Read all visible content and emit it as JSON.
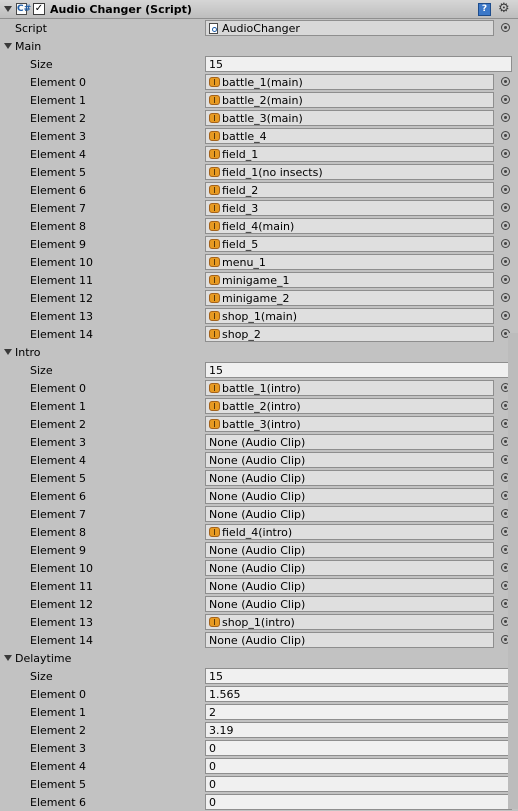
{
  "component": {
    "title": "Audio Changer (Script)",
    "enabled_mark": "✓",
    "script_icon": "C#",
    "help_icon": "?",
    "gear_icon": "⚙"
  },
  "script": {
    "label": "Script",
    "value": "AudioChanger"
  },
  "main": {
    "label": "Main",
    "size_label": "Size",
    "size": "15",
    "elements": [
      {
        "label": "Element 0",
        "value": "battle_1(main)",
        "icon": "audio-clip-icon"
      },
      {
        "label": "Element 1",
        "value": "battle_2(main)",
        "icon": "audio-clip-icon"
      },
      {
        "label": "Element 2",
        "value": "battle_3(main)",
        "icon": "audio-clip-icon"
      },
      {
        "label": "Element 3",
        "value": "battle_4",
        "icon": "audio-clip-icon"
      },
      {
        "label": "Element 4",
        "value": "field_1",
        "icon": "audio-clip-icon"
      },
      {
        "label": "Element 5",
        "value": "field_1(no insects)",
        "icon": "audio-clip-icon"
      },
      {
        "label": "Element 6",
        "value": "field_2",
        "icon": "audio-clip-icon"
      },
      {
        "label": "Element 7",
        "value": "field_3",
        "icon": "audio-clip-icon"
      },
      {
        "label": "Element 8",
        "value": "field_4(main)",
        "icon": "audio-clip-icon"
      },
      {
        "label": "Element 9",
        "value": "field_5",
        "icon": "audio-clip-icon"
      },
      {
        "label": "Element 10",
        "value": "menu_1",
        "icon": "audio-clip-icon"
      },
      {
        "label": "Element 11",
        "value": "minigame_1",
        "icon": "audio-clip-icon"
      },
      {
        "label": "Element 12",
        "value": "minigame_2",
        "icon": "audio-clip-icon"
      },
      {
        "label": "Element 13",
        "value": "shop_1(main)",
        "icon": "audio-clip-icon"
      },
      {
        "label": "Element 14",
        "value": "shop_2",
        "icon": "audio-clip-icon"
      }
    ]
  },
  "intro": {
    "label": "Intro",
    "size_label": "Size",
    "size": "15",
    "elements": [
      {
        "label": "Element 0",
        "value": "battle_1(intro)",
        "icon": "audio-clip-icon"
      },
      {
        "label": "Element 1",
        "value": "battle_2(intro)",
        "icon": "audio-clip-icon"
      },
      {
        "label": "Element 2",
        "value": "battle_3(intro)",
        "icon": "audio-clip-icon"
      },
      {
        "label": "Element 3",
        "value": "None (Audio Clip)",
        "icon": null
      },
      {
        "label": "Element 4",
        "value": "None (Audio Clip)",
        "icon": null
      },
      {
        "label": "Element 5",
        "value": "None (Audio Clip)",
        "icon": null
      },
      {
        "label": "Element 6",
        "value": "None (Audio Clip)",
        "icon": null
      },
      {
        "label": "Element 7",
        "value": "None (Audio Clip)",
        "icon": null
      },
      {
        "label": "Element 8",
        "value": "field_4(intro)",
        "icon": "audio-clip-icon"
      },
      {
        "label": "Element 9",
        "value": "None (Audio Clip)",
        "icon": null
      },
      {
        "label": "Element 10",
        "value": "None (Audio Clip)",
        "icon": null
      },
      {
        "label": "Element 11",
        "value": "None (Audio Clip)",
        "icon": null
      },
      {
        "label": "Element 12",
        "value": "None (Audio Clip)",
        "icon": null
      },
      {
        "label": "Element 13",
        "value": "shop_1(intro)",
        "icon": "audio-clip-icon"
      },
      {
        "label": "Element 14",
        "value": "None (Audio Clip)",
        "icon": null
      }
    ]
  },
  "delaytime": {
    "label": "Delaytime",
    "size_label": "Size",
    "size": "15",
    "elements": [
      {
        "label": "Element 0",
        "value": "1.565"
      },
      {
        "label": "Element 1",
        "value": "2"
      },
      {
        "label": "Element 2",
        "value": "3.19"
      },
      {
        "label": "Element 3",
        "value": "0"
      },
      {
        "label": "Element 4",
        "value": "0"
      },
      {
        "label": "Element 5",
        "value": "0"
      },
      {
        "label": "Element 6",
        "value": "0"
      }
    ]
  }
}
